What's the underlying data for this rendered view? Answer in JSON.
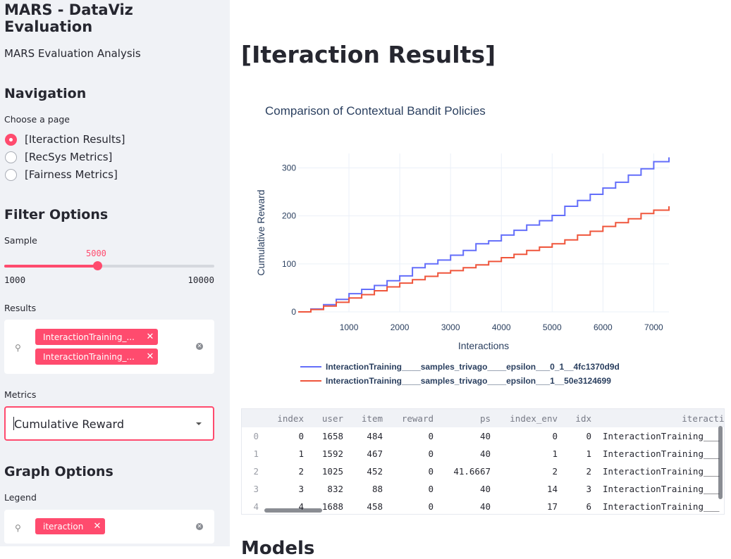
{
  "sidebar": {
    "app_title": "MARS - DataViz Evaluation",
    "subtitle": "MARS Evaluation Analysis",
    "nav_heading": "Navigation",
    "nav_prompt": "Choose a page",
    "pages": [
      {
        "label": "[Iteraction Results]",
        "selected": true
      },
      {
        "label": "[RecSys Metrics]",
        "selected": false
      },
      {
        "label": "[Fairness Metrics]",
        "selected": false
      }
    ],
    "filter_heading": "Filter Options",
    "sample_label": "Sample",
    "sample_value": "5000",
    "sample_min": "1000",
    "sample_max": "10000",
    "sample_fraction": 0.4444,
    "results_label": "Results",
    "results_tags": [
      "InteractionTraining_...",
      "InteractionTraining_..."
    ],
    "metrics_label": "Metrics",
    "metrics_value": "Cumulative Reward",
    "graph_heading": "Graph Options",
    "legend_label": "Legend",
    "legend_tags": [
      "iteraction"
    ]
  },
  "main": {
    "title": "[Iteraction Results]",
    "next_heading": "Models"
  },
  "chart_data": {
    "type": "line",
    "title": "Comparison of Contextual Bandit Policies",
    "xlabel": "Interactions",
    "ylabel": "Cumulative Reward",
    "xlim": [
      0,
      7300
    ],
    "ylim": [
      0,
      330
    ],
    "xticks": [
      1000,
      2000,
      3000,
      4000,
      5000,
      6000,
      7000
    ],
    "yticks": [
      0,
      100,
      200,
      300
    ],
    "legend_position": "bottom",
    "grid": true,
    "series": [
      {
        "name": "InteractionTraining____samples_trivago____epsilon___0_1__4fc1370d9d",
        "color": "#636efa",
        "x": [
          0,
          250,
          500,
          750,
          1000,
          1250,
          1500,
          1750,
          2000,
          2250,
          2500,
          2750,
          3000,
          3250,
          3500,
          3750,
          4000,
          4250,
          4500,
          4750,
          5000,
          5250,
          5500,
          5750,
          6000,
          6250,
          6500,
          6750,
          7000,
          7300
        ],
        "values": [
          0,
          6,
          15,
          26,
          38,
          47,
          55,
          65,
          75,
          92,
          100,
          108,
          118,
          128,
          142,
          148,
          160,
          170,
          181,
          190,
          201,
          220,
          232,
          245,
          258,
          270,
          285,
          298,
          313,
          322
        ]
      },
      {
        "name": "InteractionTraining____samples_trivago____epsilon___1__50e3124699",
        "color": "#ef553b",
        "x": [
          0,
          250,
          500,
          750,
          1000,
          1250,
          1500,
          1750,
          2000,
          2250,
          2500,
          2750,
          3000,
          3250,
          3500,
          3750,
          4000,
          4250,
          4500,
          4750,
          5000,
          5250,
          5500,
          5750,
          6000,
          6250,
          6500,
          6750,
          7000,
          7300
        ],
        "values": [
          0,
          5,
          12,
          20,
          29,
          36,
          44,
          52,
          60,
          67,
          74,
          81,
          86,
          92,
          98,
          105,
          113,
          120,
          128,
          135,
          142,
          150,
          160,
          168,
          178,
          186,
          194,
          205,
          212,
          220
        ]
      }
    ]
  },
  "dataframe": {
    "columns": [
      "index",
      "user",
      "item",
      "reward",
      "ps",
      "index_env",
      "idx",
      "iteractio"
    ],
    "rows": [
      {
        "i": "0",
        "cells": [
          "0",
          "1658",
          "484",
          "0",
          "40",
          "0",
          "0",
          "InteractionTraining___"
        ]
      },
      {
        "i": "1",
        "cells": [
          "1",
          "1592",
          "467",
          "0",
          "40",
          "1",
          "1",
          "InteractionTraining___"
        ]
      },
      {
        "i": "2",
        "cells": [
          "2",
          "1025",
          "452",
          "0",
          "41.6667",
          "2",
          "2",
          "InteractionTraining___"
        ]
      },
      {
        "i": "3",
        "cells": [
          "3",
          "832",
          "88",
          "0",
          "40",
          "14",
          "3",
          "InteractionTraining___"
        ]
      },
      {
        "i": "4",
        "cells": [
          "4",
          "1688",
          "458",
          "0",
          "40",
          "17",
          "6",
          "InteractionTraining___"
        ]
      }
    ]
  }
}
